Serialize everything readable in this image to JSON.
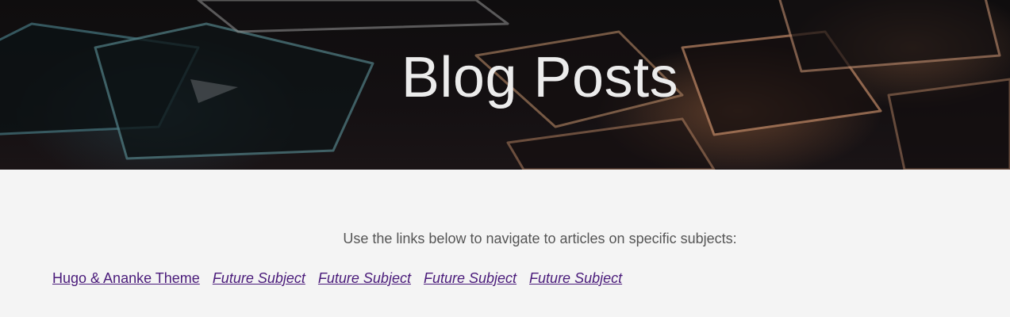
{
  "hero": {
    "title": "Blog Posts"
  },
  "main": {
    "intro": "Use the links below to navigate to articles on specific subjects:",
    "links": [
      {
        "label": "Hugo & Ananke Theme",
        "style": "normal"
      },
      {
        "label": "Future Subject",
        "style": "italic"
      },
      {
        "label": "Future Subject",
        "style": "italic"
      },
      {
        "label": "Future Subject",
        "style": "italic"
      },
      {
        "label": "Future Subject",
        "style": "italic"
      }
    ]
  },
  "colors": {
    "link": "#4a1b7a",
    "body_text": "#555555",
    "page_background": "#f4f4f4",
    "hero_title": "#ececec"
  }
}
